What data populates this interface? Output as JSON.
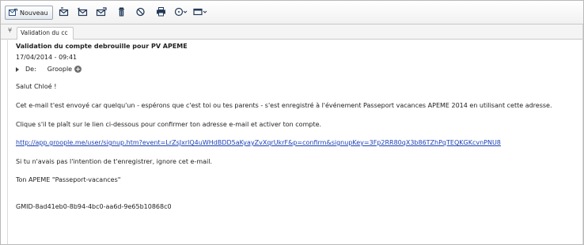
{
  "toolbar": {
    "new_label": "Nouveau",
    "icons": [
      "new-mail-icon",
      "reply-icon",
      "reply-all-icon",
      "forward-icon",
      "delete-icon",
      "block-icon",
      "print-icon",
      "more-icon",
      "move-icon"
    ]
  },
  "tabs": [
    {
      "label": "Validation du cc"
    }
  ],
  "message": {
    "subject": "Validation du compte debrouille pour PV APEME",
    "date": "17/04/2014 - 09:41",
    "to_label": "De:",
    "sender": "Groople",
    "body": {
      "greeting": "Salut Chloé !",
      "para1": "Cet e-mail t'est envoyé car quelqu'un - espérons que c'est toi ou tes parents - s'est enregistré à l'événement Passeport vacances APEME 2014 en utilisant cette adresse.",
      "para2": "Clique s'il te plaît sur le lien ci-dessous pour confirmer ton adresse e-mail et activer ton compte.",
      "link": "http://app.groople.me/user/signup.htm?event=LrZsJxrlQ4uWHdBDD5aKyayZvXqrUkrF&p=confirm&signupKey=3Fp2RR80qX3b86TZhPqTEQKGKcvnPNU8",
      "para3": "Si tu n'avais pas l'intention de t'enregistrer, ignore cet e-mail.",
      "signature": "Ton APEME \"Passeport-vacances\"",
      "gmid": "GMID-8ad41eb0-8b94-4bc0-aa6d-9e65b10868c0"
    }
  }
}
